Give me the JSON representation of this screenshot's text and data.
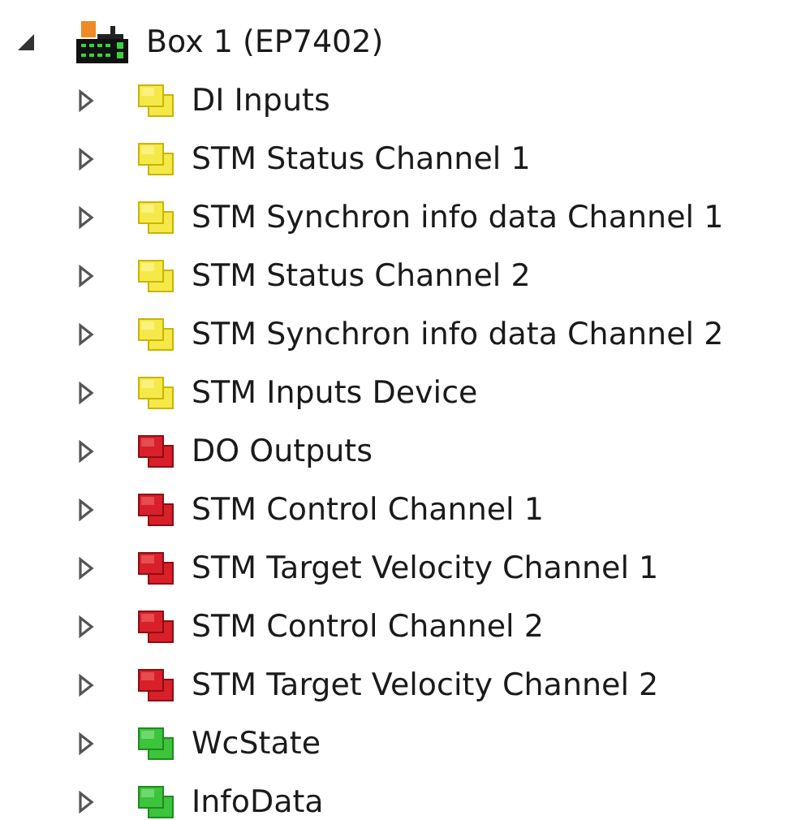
{
  "tree": [
    {
      "label": "Box 1 (EP7402)",
      "kind": "box",
      "expanded": true,
      "children": [
        {
          "label": "DI Inputs",
          "kind": "input",
          "expanded": false
        },
        {
          "label": "STM Status Channel 1",
          "kind": "input",
          "expanded": false
        },
        {
          "label": "STM Synchron info data Channel 1",
          "kind": "input",
          "expanded": false
        },
        {
          "label": "STM Status Channel 2",
          "kind": "input",
          "expanded": false
        },
        {
          "label": "STM Synchron info data Channel 2",
          "kind": "input",
          "expanded": false
        },
        {
          "label": "STM Inputs Device",
          "kind": "input",
          "expanded": false
        },
        {
          "label": "DO Outputs",
          "kind": "output",
          "expanded": false
        },
        {
          "label": "STM Control Channel 1",
          "kind": "output",
          "expanded": false
        },
        {
          "label": "STM Target Velocity Channel 1",
          "kind": "output",
          "expanded": false
        },
        {
          "label": "STM Control Channel 2",
          "kind": "output",
          "expanded": false
        },
        {
          "label": "STM Target Velocity Channel 2",
          "kind": "output",
          "expanded": false
        },
        {
          "label": "WcState",
          "kind": "status",
          "expanded": false
        },
        {
          "label": "InfoData",
          "kind": "status",
          "expanded": false
        }
      ]
    }
  ]
}
